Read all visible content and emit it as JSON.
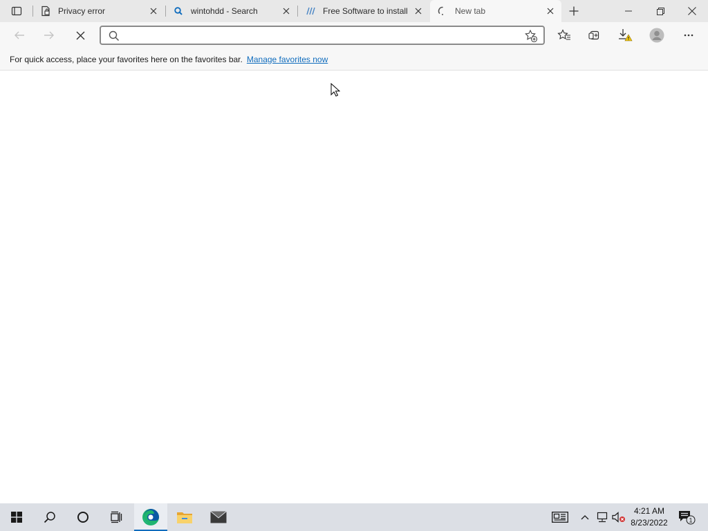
{
  "tabs": [
    {
      "title": "Privacy error",
      "icon": "privacy-error-icon",
      "active": false
    },
    {
      "title": "wintohdd - Search",
      "icon": "search-favicon-icon",
      "active": false
    },
    {
      "title": "Free Software to install",
      "icon": "site-favicon-icon",
      "active": false
    },
    {
      "title": "New tab",
      "icon": "loading-spinner-icon",
      "active": true
    }
  ],
  "address_bar": {
    "value": "",
    "placeholder": ""
  },
  "favorites_bar": {
    "message": "For quick access, place your favorites here on the favorites bar.",
    "link": "Manage favorites now"
  },
  "clock": {
    "time": "4:21 AM",
    "date": "8/23/2022"
  },
  "notification_count": "1",
  "colors": {
    "accent": "#0f6cbd",
    "tabstrip": "#e8e8e8",
    "toolbar": "#f7f7f7",
    "taskbar": "#dcdfe5"
  }
}
